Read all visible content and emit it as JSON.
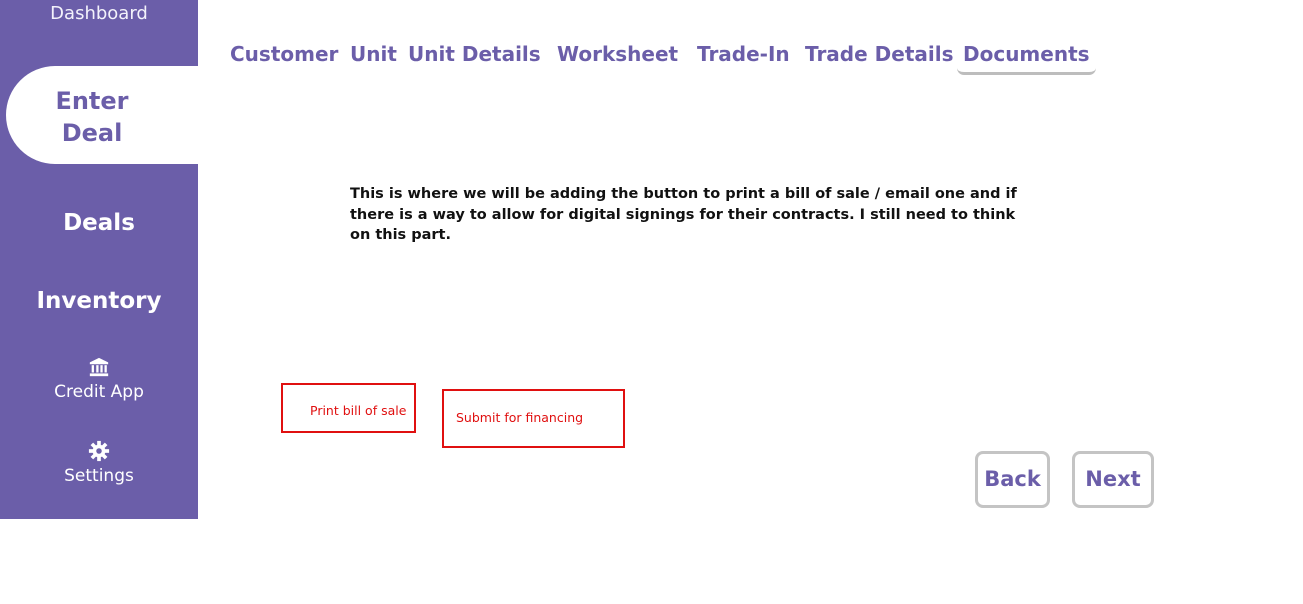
{
  "sidebar": {
    "dashboard": "Dashboard",
    "enter_deal_line1": "Enter",
    "enter_deal_line2": "Deal",
    "deals": "Deals",
    "inventory": "Inventory",
    "credit_app": "Credit App",
    "settings": "Settings",
    "credit_icon": "bank-icon",
    "settings_icon": "gear-icon"
  },
  "tabs": [
    {
      "label": "Customer"
    },
    {
      "label": "Unit"
    },
    {
      "label": "Unit Details"
    },
    {
      "label": "Worksheet"
    },
    {
      "label": "Trade-In"
    },
    {
      "label": "Trade Details"
    },
    {
      "label": "Documents",
      "active": true
    }
  ],
  "note": "This is where we will be adding the button to print a bill of sale / email one and if there is a way to allow for digital signings for their contracts. I still need to think on this part.",
  "actions": {
    "print_bill": "Print bill of sale",
    "submit_financing": "Submit for financing"
  },
  "nav": {
    "back": "Back",
    "next": "Next"
  },
  "colors": {
    "brand": "#6b5ea9",
    "annotation": "#e01010",
    "border": "#c4c4c4"
  }
}
